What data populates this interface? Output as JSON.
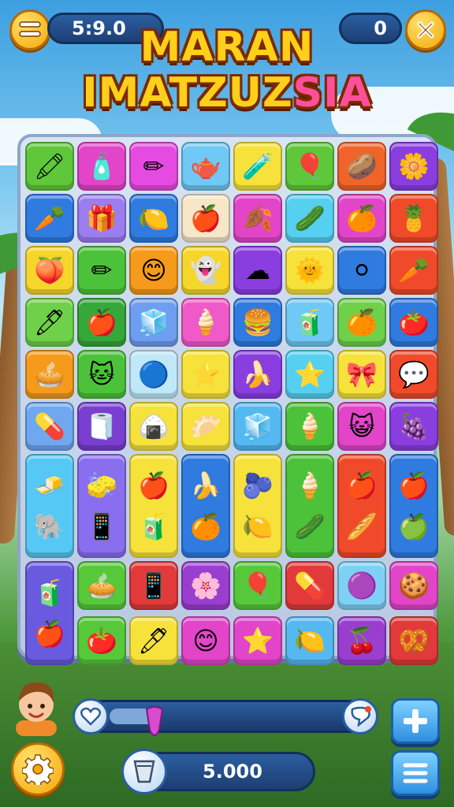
{
  "hud": {
    "timer": "5:9.0",
    "score": "0",
    "menu_icon": "menu-lines-icon",
    "close_icon": "close-x-icon"
  },
  "title": {
    "line1": "MARAN",
    "line2_main": "IMATZUZ",
    "line2_accent": "SIA"
  },
  "board": {
    "tiles": [
      {
        "g": "🖍",
        "c": "#5ec83a"
      },
      {
        "g": "🧴",
        "c": "#e245c8"
      },
      {
        "g": "✏",
        "c": "#e54be0"
      },
      {
        "g": "🫖",
        "c": "#6fc8f5"
      },
      {
        "g": "🧪",
        "c": "#f6e23a"
      },
      {
        "g": "🎈",
        "c": "#5ec83a"
      },
      {
        "g": "🥔",
        "c": "#f0642a"
      },
      {
        "g": "🌼",
        "c": "#8a3ee0"
      },
      {
        "g": "🥕",
        "c": "#2f7be0"
      },
      {
        "g": "🎁",
        "c": "#9a7ef0"
      },
      {
        "g": "🍋",
        "c": "#2f7be0"
      },
      {
        "g": "🍎",
        "c": "#f7e6c8"
      },
      {
        "g": "🍂",
        "c": "#e245c8"
      },
      {
        "g": "🥒",
        "c": "#56d0f0"
      },
      {
        "g": "🍊",
        "c": "#e245c8"
      },
      {
        "g": "🍍",
        "c": "#f04a2a"
      },
      {
        "g": "🍑",
        "c": "#f6d62a"
      },
      {
        "g": "✏",
        "c": "#4cc23a"
      },
      {
        "g": "😊",
        "c": "#f59a1a"
      },
      {
        "g": "👻",
        "c": "#f6d62a"
      },
      {
        "g": "☁",
        "c": "#8a3ee0"
      },
      {
        "g": "🌞",
        "c": "#f6e23a"
      },
      {
        "g": "⚪",
        "c": "#2f7be0"
      },
      {
        "g": "🥕",
        "c": "#f04a2a"
      },
      {
        "g": "🖊",
        "c": "#6fd04a"
      },
      {
        "g": "🍎",
        "c": "#34a83a"
      },
      {
        "g": "🧊",
        "c": "#6f9ef0"
      },
      {
        "g": "🍦",
        "c": "#f05ac8"
      },
      {
        "g": "🍔",
        "c": "#2f7be0"
      },
      {
        "g": "🧃",
        "c": "#6fc8f5"
      },
      {
        "g": "🍊",
        "c": "#6fd04a"
      },
      {
        "g": "🍅",
        "c": "#2f7be0"
      },
      {
        "g": "🥧",
        "c": "#f59a1a"
      },
      {
        "g": "🐱",
        "c": "#4cc23a"
      },
      {
        "g": "🔵",
        "c": "#bfe8f8"
      },
      {
        "g": "⭐",
        "c": "#f6e23a"
      },
      {
        "g": "🍌",
        "c": "#8a3ee0"
      },
      {
        "g": "⭐",
        "c": "#56d0f0"
      },
      {
        "g": "🎀",
        "c": "#f6e23a"
      },
      {
        "g": "💬",
        "c": "#f04a2a"
      },
      {
        "g": "💊",
        "c": "#6fa8f0"
      },
      {
        "g": "🧻",
        "c": "#7a3ed0"
      },
      {
        "g": "🍙",
        "c": "#f6e23a"
      },
      {
        "g": "🥟",
        "c": "#f6e23a"
      },
      {
        "g": "🧊",
        "c": "#56b8f0"
      },
      {
        "g": "🍦",
        "c": "#4cc23a"
      },
      {
        "g": "😺",
        "c": "#e245c8"
      },
      {
        "g": "🍇",
        "c": "#8a3ee0"
      }
    ],
    "tall_tiles": [
      {
        "a": "🧈",
        "b": "🐘",
        "c": "#56c8f5"
      },
      {
        "a": "🧽",
        "b": "📱",
        "c": "#8a6ef0"
      },
      {
        "a": "🍎",
        "b": "🧃",
        "c": "#f6e23a"
      },
      {
        "a": "🍌",
        "b": "🍊",
        "c": "#2f7be0"
      },
      {
        "a": "🫐",
        "b": "🍋",
        "c": "#f6e23a"
      },
      {
        "a": "🍦",
        "b": "🥒",
        "c": "#4cc23a"
      },
      {
        "a": "🍎",
        "b": "🥖",
        "c": "#f04a2a"
      },
      {
        "a": "🍎",
        "b": "🍏",
        "c": "#2f7be0"
      },
      {
        "a": "🧃",
        "b": "🍎",
        "c": "#6a5ae0"
      }
    ],
    "bottom_tiles": [
      {
        "g": "🥧",
        "c": "#56c83a"
      },
      {
        "g": "📱",
        "c": "#e23a3a"
      },
      {
        "g": "🌸",
        "c": "#9a3ed0"
      },
      {
        "g": "🎈",
        "c": "#56c83a"
      },
      {
        "g": "💊",
        "c": "#e23a3a"
      },
      {
        "g": "🟣",
        "c": "#7ed0f5"
      },
      {
        "g": "🍪",
        "c": "#e245c8"
      },
      {
        "g": "🍅",
        "c": "#56c83a"
      },
      {
        "g": "🖊",
        "c": "#f6e23a"
      },
      {
        "g": "😊",
        "c": "#e245c8"
      },
      {
        "g": "⭐",
        "c": "#e245c8"
      },
      {
        "g": "🍋",
        "c": "#56b8f0"
      },
      {
        "g": "🍒",
        "c": "#9a3ed0"
      },
      {
        "g": "🥨",
        "c": "#e23a3a"
      }
    ]
  },
  "footer": {
    "currency": "5.000",
    "progress_fraction": 0.2,
    "settings_icon": "gear-icon",
    "plus_icon": "plus-icon",
    "list_icon": "hamburger-icon",
    "heart_icon": "heart-icon",
    "chat_icon": "chat-bubble-icon",
    "cup_icon": "cup-icon"
  }
}
